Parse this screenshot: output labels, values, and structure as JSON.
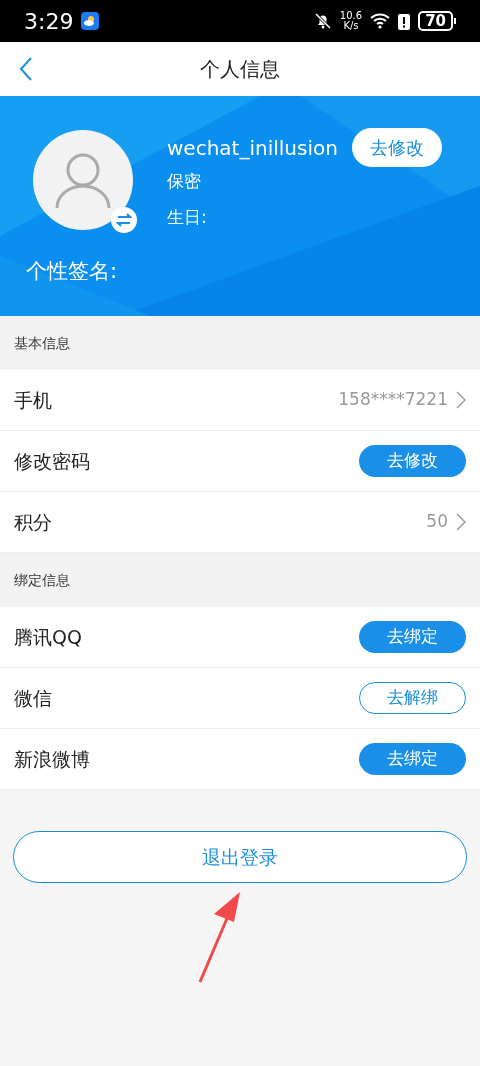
{
  "status_bar": {
    "time": "3:29",
    "speed_value": "10.6",
    "speed_unit": "K/s",
    "battery": "70"
  },
  "nav": {
    "title": "个人信息"
  },
  "profile": {
    "username": "wechat_inillusion",
    "edit_button": "去修改",
    "gender": "保密",
    "birthday": "生日:",
    "signature": "个性签名:"
  },
  "sections": [
    {
      "title": "基本信息",
      "rows": [
        {
          "kind": "value",
          "label": "手机",
          "value": "158****7221"
        },
        {
          "kind": "action",
          "label": "修改密码",
          "button": {
            "label": "去修改",
            "outlined": false
          }
        },
        {
          "kind": "value",
          "label": "积分",
          "value": "50"
        }
      ]
    },
    {
      "title": "绑定信息",
      "rows": [
        {
          "kind": "action",
          "label": "腾讯QQ",
          "button": {
            "label": "去绑定",
            "outlined": false
          }
        },
        {
          "kind": "action",
          "label": "微信",
          "button": {
            "label": "去解绑",
            "outlined": true
          }
        },
        {
          "kind": "action",
          "label": "新浪微博",
          "button": {
            "label": "去绑定",
            "outlined": false
          }
        }
      ]
    }
  ],
  "logout_button": "退出登录"
}
